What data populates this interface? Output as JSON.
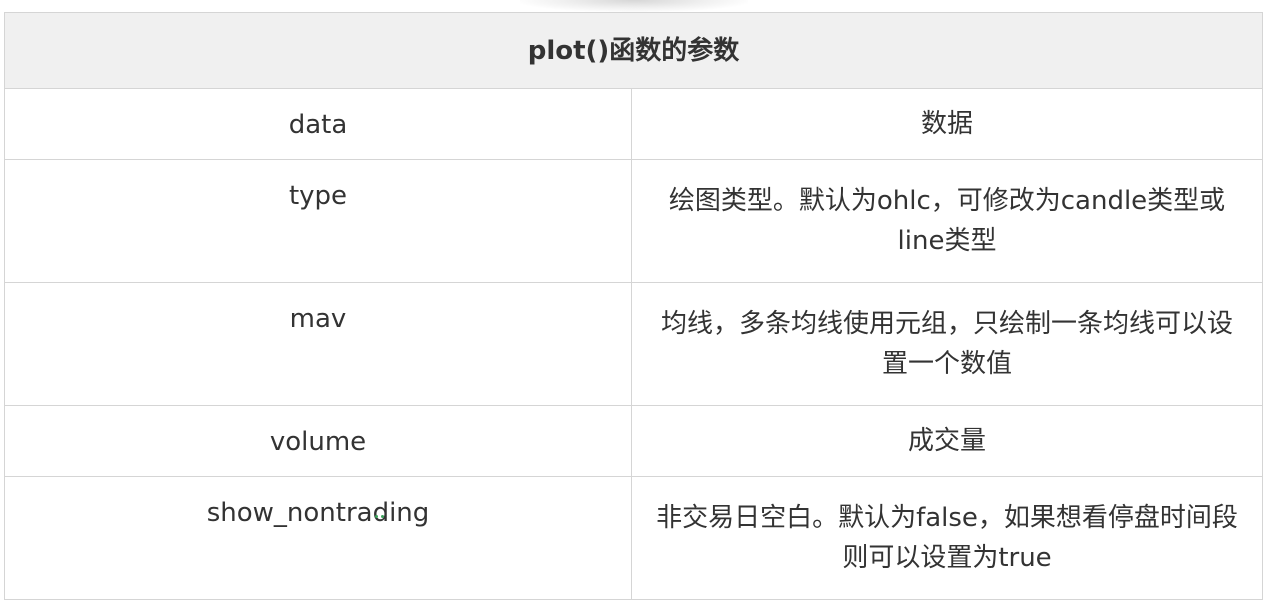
{
  "table": {
    "header": "plot()函数的参数",
    "rows": [
      {
        "name": "data",
        "desc": "数据"
      },
      {
        "name": "type",
        "desc": "绘图类型。默认为ohlc，可修改为candle类型或line类型"
      },
      {
        "name": "mav",
        "desc": "均线，多条均线使用元组，只绘制一条均线可以设置一个数值"
      },
      {
        "name": "volume",
        "desc": "成交量"
      },
      {
        "name": "show_nontrading",
        "desc": "非交易日空白。默认为false，如果想看停盘时间段则可以设置为true"
      }
    ]
  },
  "colors": {
    "header_bg": "#f0f0f0",
    "border": "#d5d5d5",
    "text": "#333333",
    "marker": "#3aa25a"
  }
}
